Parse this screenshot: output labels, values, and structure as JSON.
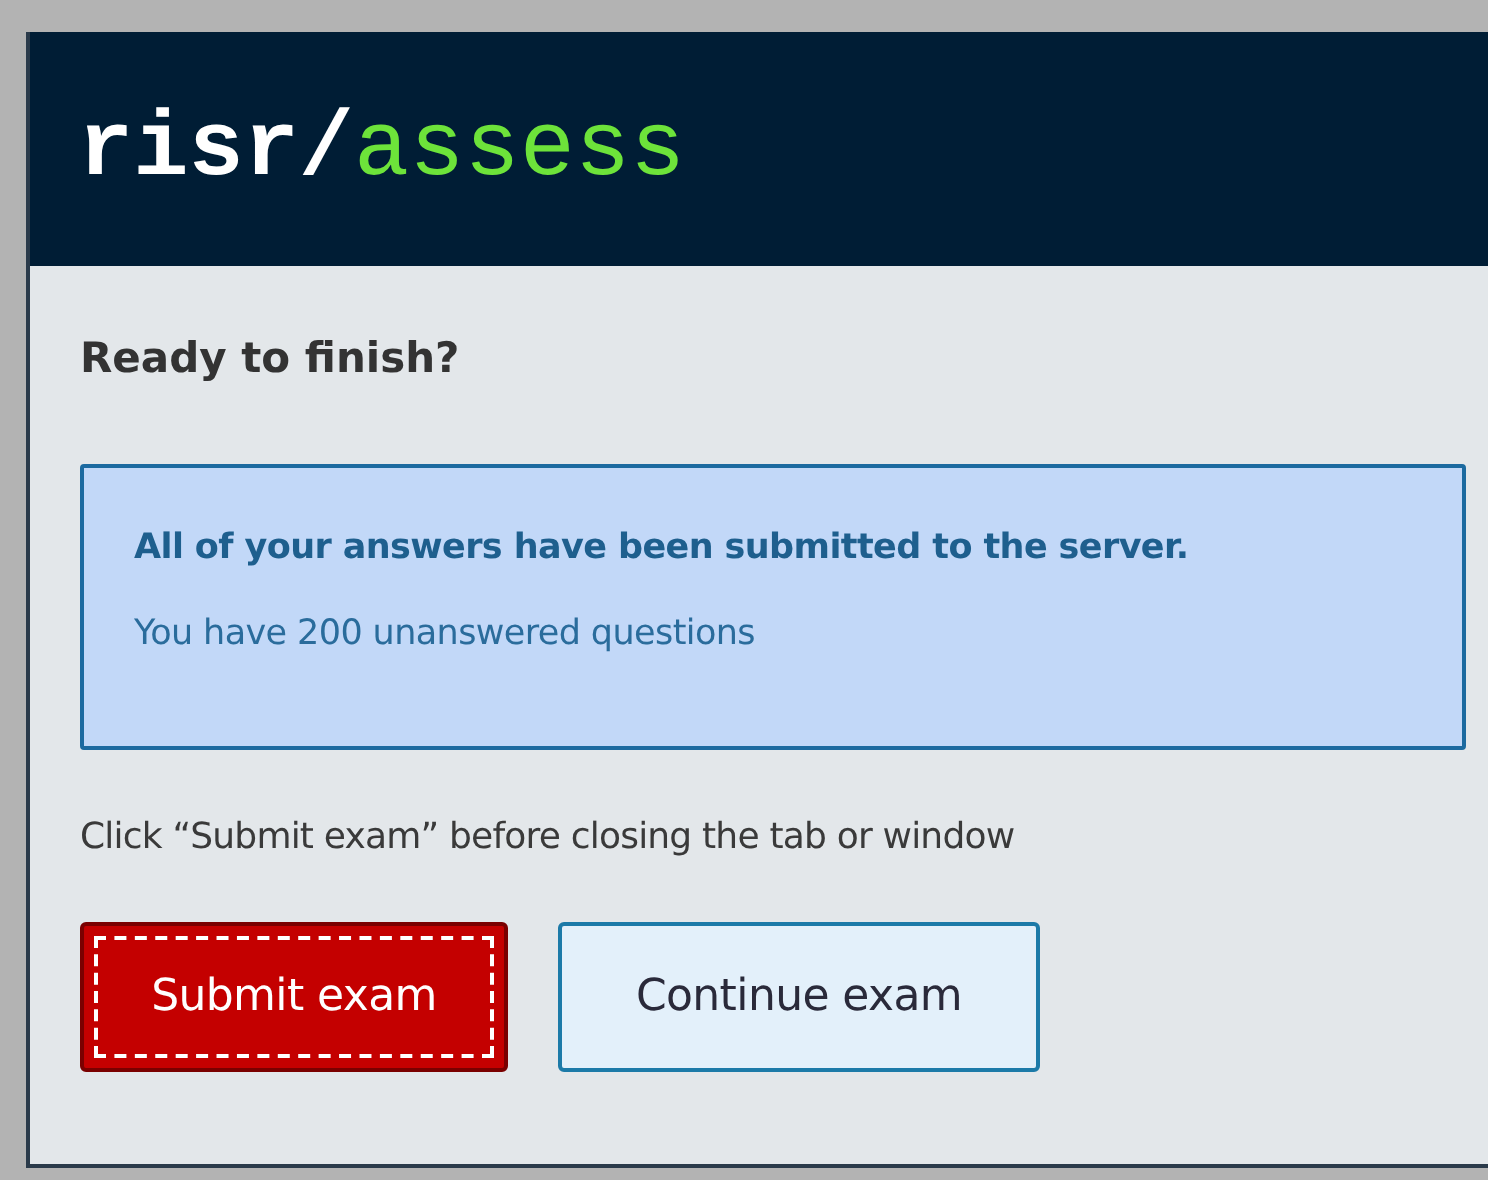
{
  "header": {
    "logo_brand": "risr/",
    "logo_product": "assess"
  },
  "dialog": {
    "title": "Ready to finish?",
    "notice": {
      "heading": "All of your answers have been submitted to the server.",
      "detail": "You have 200 unanswered questions"
    },
    "instruction": "Click “Submit exam” before closing the tab or window",
    "buttons": [
      {
        "label": "Submit exam",
        "kind": "primary",
        "focused": true
      },
      {
        "label": "Continue exam",
        "kind": "secondary",
        "focused": false
      }
    ]
  }
}
